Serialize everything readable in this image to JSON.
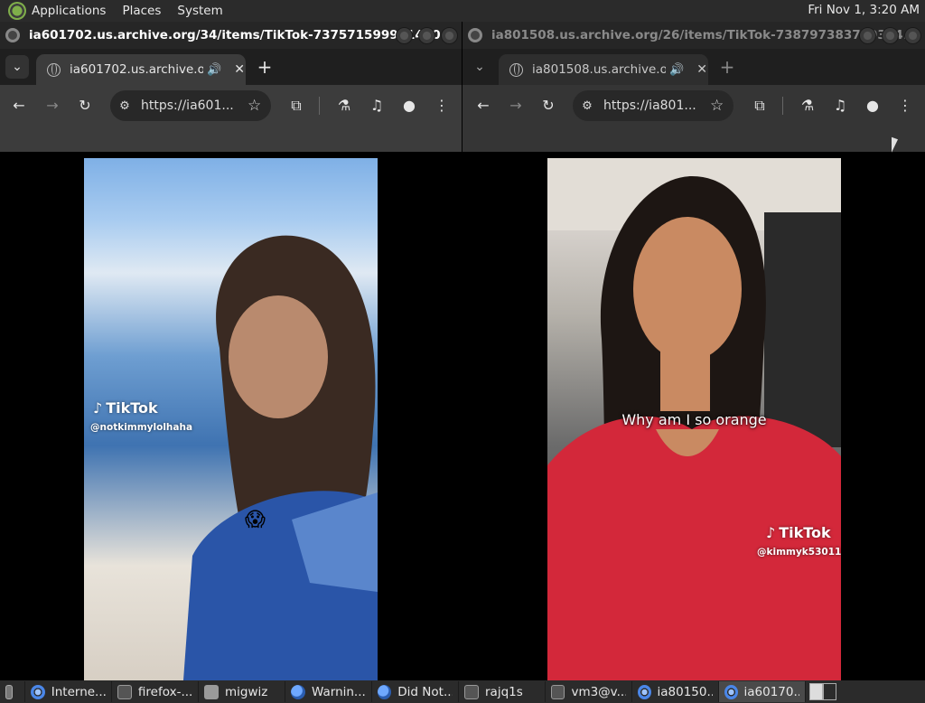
{
  "top_panel": {
    "menus": [
      "Applications",
      "Places",
      "System"
    ],
    "clock": "Fri Nov  1,  3:20 AM"
  },
  "left_window": {
    "title": "ia601702.us.archive.org/34/items/TikTok-737571599941430...",
    "tab_label": "ia601702.us.archive.org/34",
    "omnibox_url": "https://ia601...",
    "video": {
      "tiktok_logo": "TikTok",
      "handle": "@notkimmylolhaha",
      "emoji": "😱"
    }
  },
  "right_window": {
    "title": "ia801508.us.archive.org/26/items/TikTok-738797383789324...",
    "tab_label": "ia801508.us.archive.org/26",
    "omnibox_url": "https://ia801...",
    "video": {
      "caption": "Why am I so orange",
      "tiktok_logo": "TikTok",
      "handle": "@kimmyk53011"
    }
  },
  "taskbar": {
    "items": [
      {
        "label": "Interne...",
        "icon": "chrome-icon"
      },
      {
        "label": "firefox-...",
        "icon": "terminal-icon"
      },
      {
        "label": "migwiz",
        "icon": "folder-icon"
      },
      {
        "label": "Warnin...",
        "icon": "firefox-icon"
      },
      {
        "label": "Did Not...",
        "icon": "firefox-icon"
      },
      {
        "label": "rajq1s",
        "icon": "terminal-icon"
      },
      {
        "label": "vm3@v...",
        "icon": "terminal-icon"
      },
      {
        "label": "ia80150...",
        "icon": "chrome-icon"
      },
      {
        "label": "ia60170...",
        "icon": "chrome-icon"
      }
    ]
  }
}
